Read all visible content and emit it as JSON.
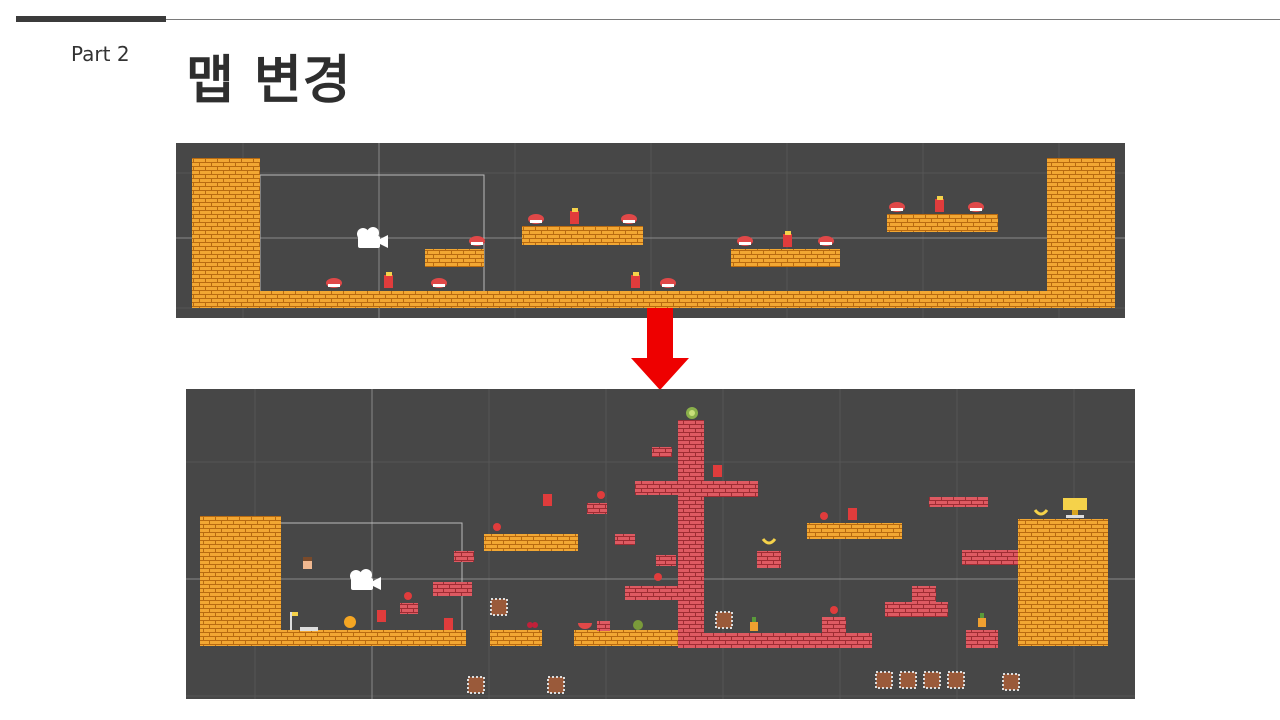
{
  "slide": {
    "part_label": "Part 2",
    "title": "맵 변경"
  },
  "colors": {
    "background": "#ffffff",
    "editor_background": "#474747",
    "grid_line": "#555555",
    "orange_brick": "#f0a030",
    "red_brick": "#d9535b",
    "arrow": "#ee0000",
    "enemy_red": "#e03c3c",
    "enemy_mushroom": "#e04848"
  },
  "scenes": {
    "before": {
      "name": "map-before",
      "icon": "camera-icon"
    },
    "after": {
      "name": "map-after",
      "icon": "camera-icon"
    }
  },
  "arrow": {
    "direction": "down",
    "icon": "down-arrow-icon"
  }
}
